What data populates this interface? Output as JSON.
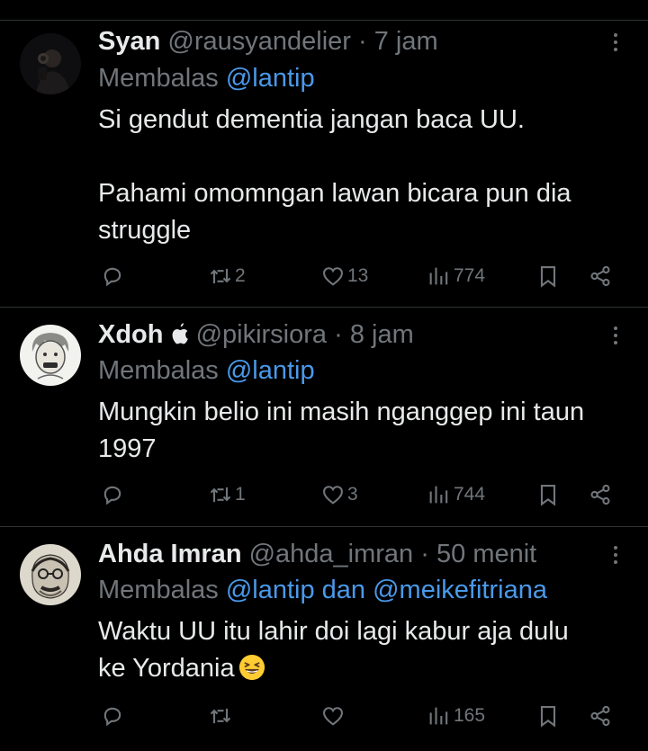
{
  "tweets": [
    {
      "name": "Syan",
      "handle": "@rausyandelier",
      "sep": "·",
      "time": "7 jam",
      "reply_prefix": "Membalas",
      "reply_to": "@lantip",
      "body": [
        "Si gendut dementia jangan baca UU.",
        "",
        "Pahami omomngan lawan bicara pun dia",
        "struggle"
      ],
      "retweets": "2",
      "likes": "13",
      "views": "774",
      "avatar": "dark-portrait"
    },
    {
      "name": "Xdoh",
      "handle": "@pikirsiora",
      "sep": "·",
      "time": "8 jam",
      "reply_prefix": "Membalas",
      "reply_to": "@lantip",
      "body": [
        "Mungkin belio ini masih nganggep ini taun",
        "1997"
      ],
      "retweets": "1",
      "likes": "3",
      "views": "744",
      "avatar": "cartoon-face",
      "name_icon": "apple-icon"
    },
    {
      "name": "Ahda Imran",
      "handle": "@ahda_imran",
      "sep": "·",
      "time": "50 menit",
      "reply_prefix": "Membalas",
      "reply_to": "@lantip dan @meikefitriana",
      "body": [
        "Waktu UU itu lahir doi lagi kabur aja dulu",
        "ke Yordania"
      ],
      "retweets": "",
      "likes": "",
      "views": "165",
      "avatar": "sketch-portrait",
      "body_emoji": "grinning-squinting-face-emoji"
    }
  ],
  "colors": {
    "background": "#000000",
    "text": "#e7e9ea",
    "muted": "#71767b",
    "link": "#4a99e9",
    "divider": "#2f3336"
  }
}
